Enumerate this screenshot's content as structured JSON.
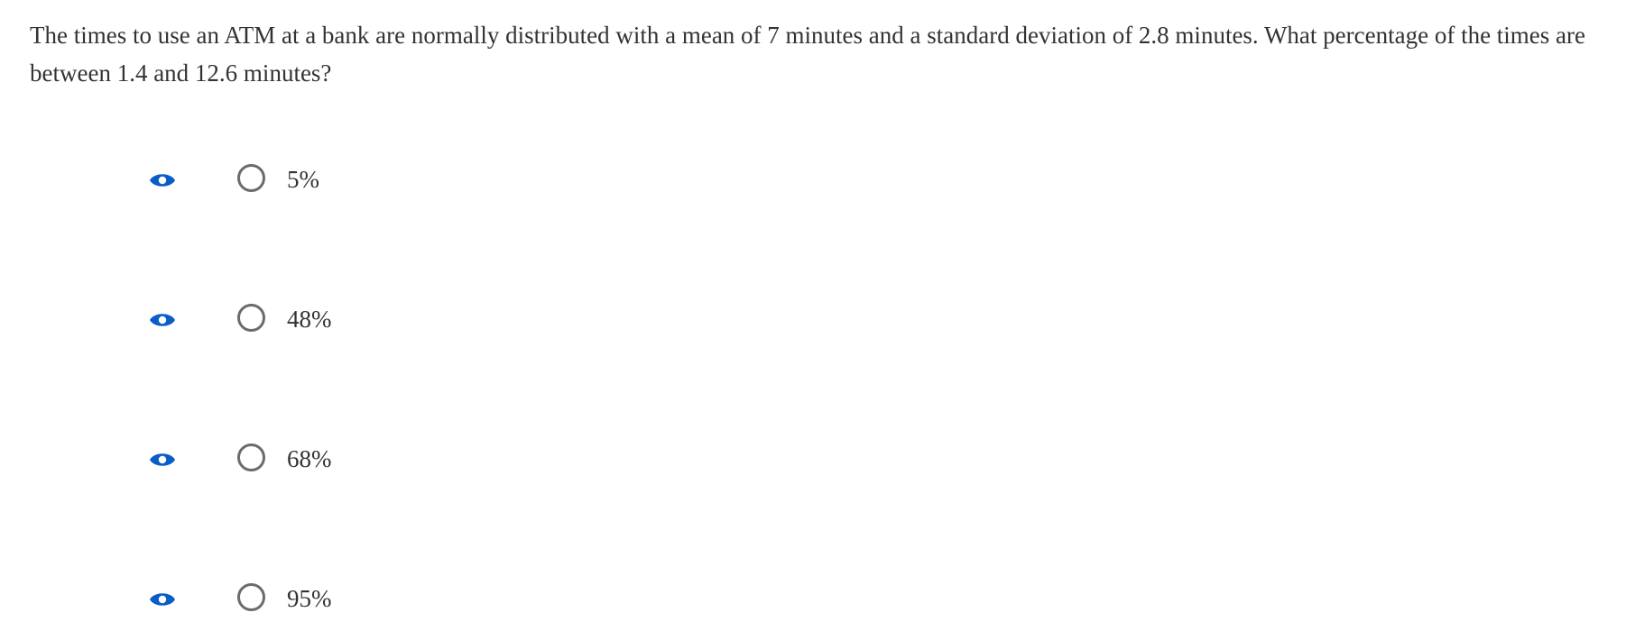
{
  "question": {
    "text": "The times to use an ATM at a bank are normally distributed with a mean of 7 minutes and a standard deviation of 2.8 minutes. What percentage of the times are between 1.4 and 12.6 minutes?"
  },
  "options": [
    {
      "label": "5%",
      "icon": "eye-icon"
    },
    {
      "label": "48%",
      "icon": "eye-icon"
    },
    {
      "label": "68%",
      "icon": "eye-icon"
    },
    {
      "label": "95%",
      "icon": "eye-icon"
    }
  ],
  "colors": {
    "accent": "#0a5cc7",
    "text": "#333333",
    "radio_border": "#6b6b6b"
  }
}
